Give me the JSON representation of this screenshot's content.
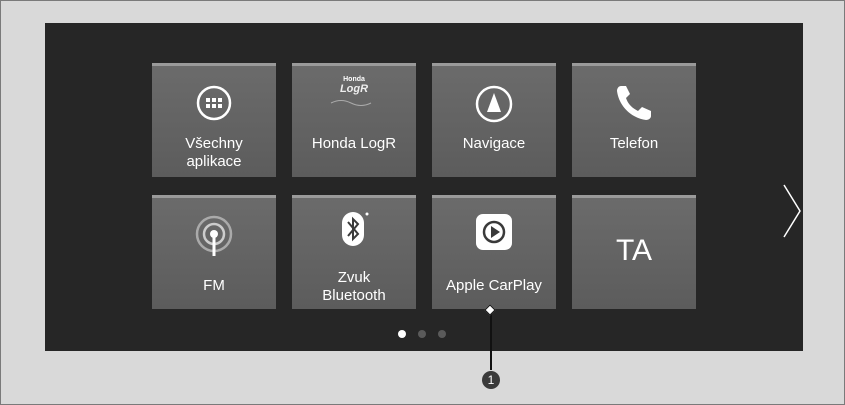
{
  "apps": {
    "all_apps": "Všechny aplikace",
    "honda_logr": "Honda LogR",
    "honda_logo_small": "Honda",
    "logr_logo": "LogR",
    "navigation": "Navigace",
    "phone": "Telefon",
    "fm": "FM",
    "bluetooth_audio": "Zvuk Bluetooth",
    "apple_carplay": "Apple CarPlay",
    "ta": "TA"
  },
  "pager": {
    "current_page": 1,
    "total_pages": 3
  },
  "callout": {
    "number": "1"
  },
  "colors": {
    "tile_bg": "#616161",
    "screen_bg": "#262626",
    "active_dot": "#ffffff",
    "inactive_dot": "#5a5a5a"
  }
}
